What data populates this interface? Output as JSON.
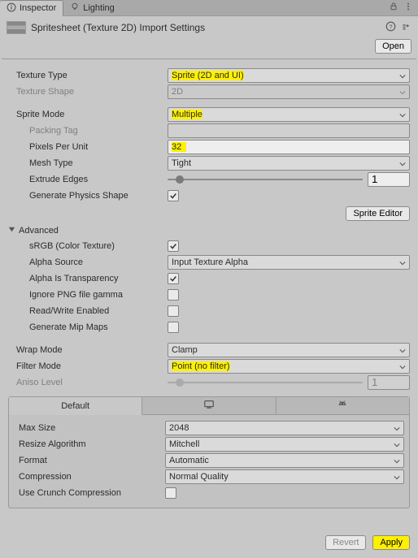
{
  "tabs": {
    "inspector": "Inspector",
    "lighting": "Lighting"
  },
  "header": {
    "title": "Spritesheet (Texture 2D) Import Settings",
    "open": "Open"
  },
  "textureType": {
    "label": "Texture Type",
    "value": "Sprite (2D and UI)"
  },
  "textureShape": {
    "label": "Texture Shape",
    "value": "2D"
  },
  "spriteMode": {
    "label": "Sprite Mode",
    "value": "Multiple"
  },
  "packingTag": {
    "label": "Packing Tag",
    "value": ""
  },
  "pixelsPerUnit": {
    "label": "Pixels Per Unit",
    "value": "32"
  },
  "meshType": {
    "label": "Mesh Type",
    "value": "Tight"
  },
  "extrudeEdges": {
    "label": "Extrude Edges",
    "value": "1"
  },
  "generatePhysics": {
    "label": "Generate Physics Shape"
  },
  "spriteEditor": "Sprite Editor",
  "advanced": "Advanced",
  "srgb": {
    "label": "sRGB (Color Texture)"
  },
  "alphaSource": {
    "label": "Alpha Source",
    "value": "Input Texture Alpha"
  },
  "alphaIsTrans": {
    "label": "Alpha Is Transparency"
  },
  "ignorePng": {
    "label": "Ignore PNG file gamma"
  },
  "readWrite": {
    "label": "Read/Write Enabled"
  },
  "mipMaps": {
    "label": "Generate Mip Maps"
  },
  "wrapMode": {
    "label": "Wrap Mode",
    "value": "Clamp"
  },
  "filterMode": {
    "label": "Filter Mode",
    "value": "Point (no filter)"
  },
  "aniso": {
    "label": "Aniso Level",
    "value": "1"
  },
  "platform": {
    "default": "Default"
  },
  "maxSize": {
    "label": "Max Size",
    "value": "2048"
  },
  "resize": {
    "label": "Resize Algorithm",
    "value": "Mitchell"
  },
  "format": {
    "label": "Format",
    "value": "Automatic"
  },
  "compression": {
    "label": "Compression",
    "value": "Normal Quality"
  },
  "crunch": {
    "label": "Use Crunch Compression"
  },
  "footer": {
    "revert": "Revert",
    "apply": "Apply"
  },
  "colors": {
    "highlight": "#fff000"
  }
}
